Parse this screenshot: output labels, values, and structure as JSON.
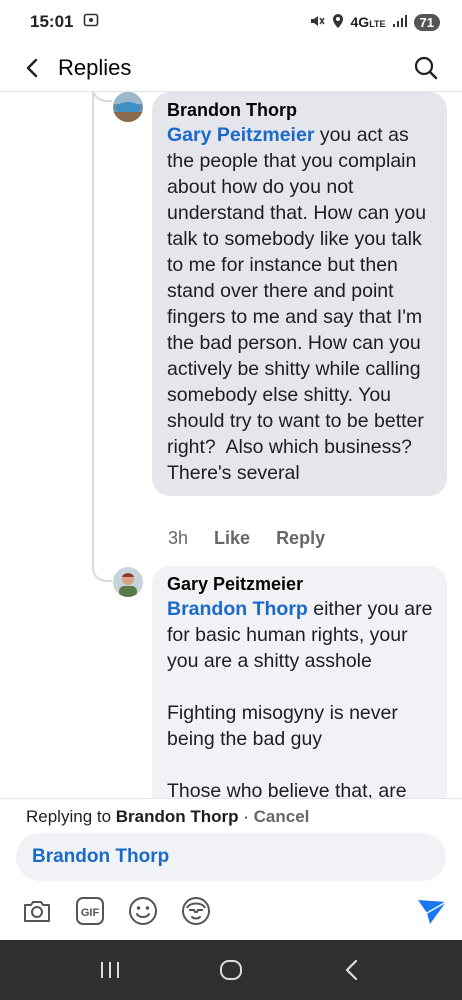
{
  "status_bar": {
    "time": "15:01",
    "network": "4G",
    "network_sub": "LTE",
    "battery": "71"
  },
  "header": {
    "title": "Replies"
  },
  "comments": [
    {
      "author": "Brandon Thorp",
      "mention": "Gary Peitzmeier",
      "text": " you act as the people that you complain about how do you not understand that. How can you talk to somebody like you talk to me for instance but then stand over there and point fingers to me and say that I'm the bad person. How can you actively be shitty while calling somebody else shitty. You should try to want to be better right?  Also which business? There's several",
      "time": "3h",
      "like_label": "Like",
      "reply_label": "Reply"
    },
    {
      "author": "Gary Peitzmeier",
      "mention": "Brandon Thorp",
      "text": " either you are for basic human rights, your you are a shitty asshole\n\nFighting misogyny is never being the bad guy\n\nThose who believe that, are"
    }
  ],
  "reply_bar": {
    "replying_prefix": "Replying to ",
    "replying_name": "Brandon Thorp",
    "separator": " · ",
    "cancel_label": "Cancel",
    "input_value": "Brandon Thorp"
  },
  "toolbar": {
    "icons": [
      "camera-icon",
      "gif-icon",
      "emoji-icon",
      "avatar-sticker-icon",
      "send-icon"
    ]
  },
  "colors": {
    "mention": "#1b6ac9",
    "bubble": "#e4e6eb",
    "send": "#1877f2"
  }
}
